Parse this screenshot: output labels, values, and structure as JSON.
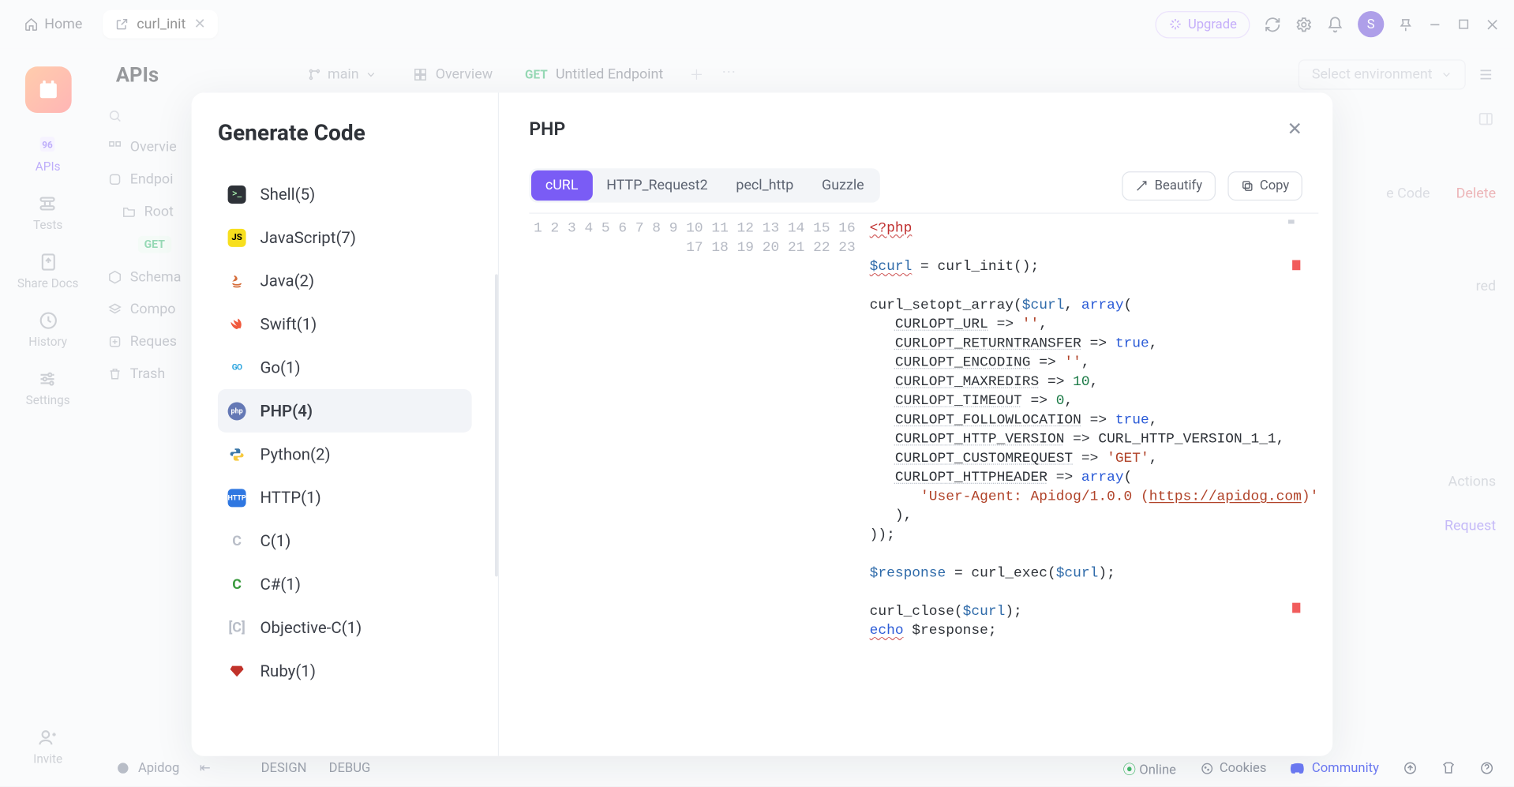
{
  "topbar": {
    "home": "Home",
    "tab_title": "curl_init",
    "upgrade": "Upgrade",
    "avatar_initial": "S"
  },
  "leftRail": {
    "items": [
      "APIs",
      "Tests",
      "Share Docs",
      "History",
      "Settings",
      "Invite"
    ]
  },
  "mainHead": {
    "apis_title": "APIs",
    "branch": "main",
    "overview_tab": "Overview",
    "endpoint_method": "GET",
    "endpoint_title": "Untitled Endpoint",
    "env_placeholder": "Select environment"
  },
  "sideTree": {
    "rows": [
      "Overvie",
      "Endpoi",
      "Root",
      "GET",
      "Schema",
      "Compo",
      "Reques",
      "Trash"
    ]
  },
  "rightFaded": {
    "gen_code": "e Code",
    "delete": "Delete",
    "red": "red",
    "actions": "Actions",
    "request": "Request"
  },
  "modal": {
    "title": "Generate Code",
    "selected_lang_title": "PHP",
    "languages": [
      {
        "icon": "shell",
        "label": "Shell(5)"
      },
      {
        "icon": "js",
        "label": "JavaScript(7)"
      },
      {
        "icon": "java",
        "label": "Java(2)"
      },
      {
        "icon": "swift",
        "label": "Swift(1)"
      },
      {
        "icon": "go",
        "label": "Go(1)"
      },
      {
        "icon": "php",
        "label": "PHP(4)",
        "active": true
      },
      {
        "icon": "python",
        "label": "Python(2)"
      },
      {
        "icon": "http",
        "label": "HTTP(1)"
      },
      {
        "icon": "c",
        "label": "C(1)"
      },
      {
        "icon": "csharp",
        "label": "C#(1)"
      },
      {
        "icon": "objc",
        "label": "Objective-C(1)"
      },
      {
        "icon": "ruby",
        "label": "Ruby(1)"
      }
    ],
    "lib_tabs": [
      "cURL",
      "HTTP_Request2",
      "pecl_http",
      "Guzzle"
    ],
    "lib_active": 0,
    "beautify": "Beautify",
    "copy": "Copy",
    "code_lines": {
      "l1": "<?php",
      "l3_var": "$curl",
      "l3_rest": " = curl_init();",
      "l5a": "curl_setopt_array(",
      "l5b": "$curl",
      "l5c": ", ",
      "l5d": "array",
      "l5e": "(",
      "opt_url": "CURLOPT_URL",
      "opt_url_v": "''",
      "opt_rt": "CURLOPT_RETURNTRANSFER",
      "opt_enc": "CURLOPT_ENCODING",
      "opt_enc_v": "''",
      "opt_max": "CURLOPT_MAXREDIRS",
      "opt_max_v": "10",
      "opt_to": "CURLOPT_TIMEOUT",
      "opt_to_v": "0",
      "opt_fl": "CURLOPT_FOLLOWLOCATION",
      "opt_hv": "CURLOPT_HTTP_VERSION",
      "opt_hv_v": "CURL_HTTP_VERSION_1_1",
      "opt_cr": "CURLOPT_CUSTOMREQUEST",
      "opt_cr_v": "'GET'",
      "opt_hh": "CURLOPT_HTTPHEADER",
      "ua_left": "'User-Agent: Apidog/1.0.0 (",
      "ua_link": "https://apidog.com",
      "ua_right": ")'",
      "l19a": "$response",
      "l19b": " = curl_exec(",
      "l19c": "$curl",
      "l19d": ");",
      "l21a": "curl_close(",
      "l21b": "$curl",
      "l21c": ");",
      "l22a": "echo",
      "l22b": " $response;"
    }
  },
  "bottombar": {
    "brand": "Apidog",
    "design": "DESIGN",
    "debug": "DEBUG",
    "online": "Online",
    "cookies": "Cookies",
    "community": "Community"
  }
}
